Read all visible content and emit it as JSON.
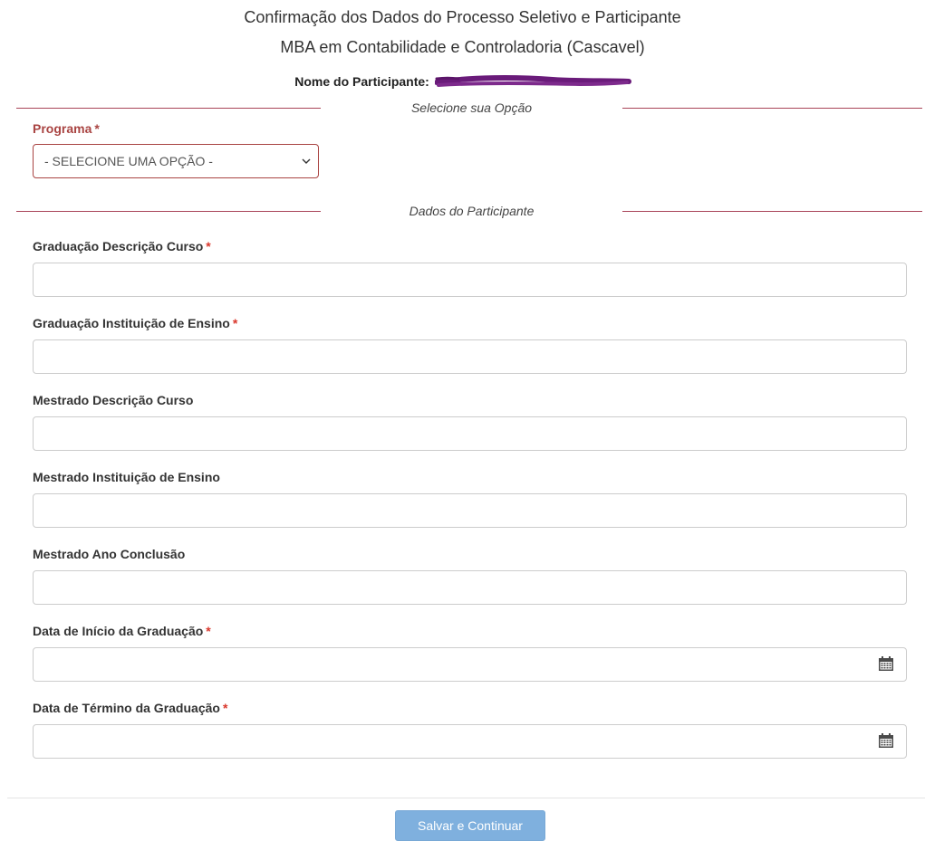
{
  "header": {
    "title": "Confirmação dos Dados do Processo Seletivo e Participante",
    "subtitle": "MBA em Contabilidade e Controladoria (Cascavel)",
    "participant_label": "Nome do Participante:"
  },
  "sections": {
    "option_legend": "Selecione sua Opção",
    "participant_legend": "Dados do Participante"
  },
  "program": {
    "label": "Programa",
    "required_mark": "*",
    "selected": "- SELECIONE UMA OPÇÃO -"
  },
  "fields": [
    {
      "label": "Graduação Descrição Curso",
      "required_mark": "*",
      "value": ""
    },
    {
      "label": "Graduação Instituição de Ensino",
      "required_mark": "*",
      "value": ""
    },
    {
      "label": "Mestrado Descrição Curso",
      "required_mark": "",
      "value": ""
    },
    {
      "label": "Mestrado Instituição de Ensino",
      "required_mark": "",
      "value": ""
    },
    {
      "label": "Mestrado Ano Conclusão",
      "required_mark": "",
      "value": ""
    },
    {
      "label": "Data de Início da Graduação",
      "required_mark": "*",
      "value": "",
      "icon": "calendar-icon"
    },
    {
      "label": "Data de Término da Graduação",
      "required_mark": "*",
      "value": "",
      "icon": "calendar-icon"
    }
  ],
  "actions": {
    "submit_label": "Salvar e Continuar"
  },
  "colors": {
    "divider": "#a94458",
    "error": "#a94442",
    "required": "#d9362b",
    "button": "#7fb0de",
    "redaction": "#6a1b7a"
  }
}
